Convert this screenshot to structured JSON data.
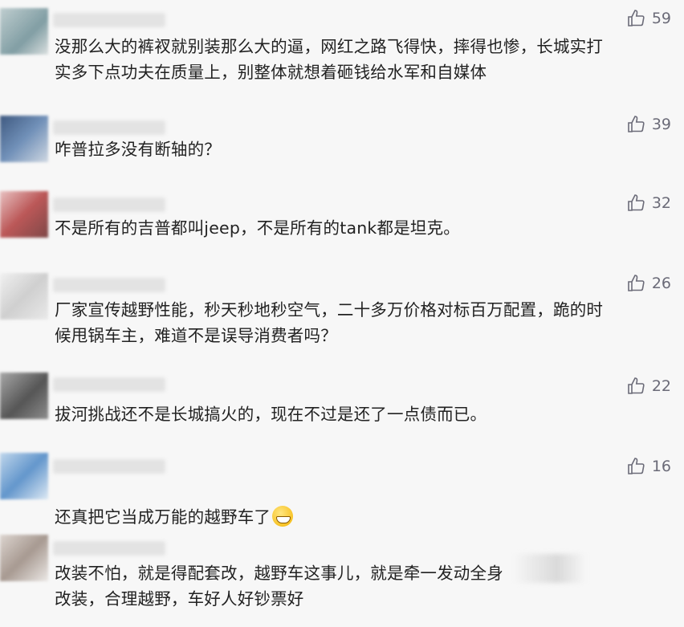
{
  "comments": [
    {
      "avatar_color": "#7aa0a8",
      "text": "没那么大的裤衩就别装那么大的逼，网红之路飞得快，摔得也惨，长城实打\n实多下点功夫在质量上，别整体就想着砸钱给水军和自媒体",
      "likes": "59"
    },
    {
      "avatar_color": "#3b5b88",
      "text": "咋普拉多没有断轴的？",
      "likes": "39"
    },
    {
      "avatar_color": "#b13c3c",
      "text": "不是所有的吉普都叫jeep，不是所有的tank都是坦克。",
      "likes": "32"
    },
    {
      "avatar_color": "#c9c9c9",
      "text": "厂家宣传越野性能，秒天秒地秒空气，二十多万价格对标百万配置，跪的时\n候甩锅车主，难道不是误导消费者吗？",
      "likes": "26"
    },
    {
      "avatar_color": "#5a5a5a",
      "text": "拔河挑战还不是长城搞火的，现在不过是还了一点债而已。",
      "likes": "22"
    },
    {
      "avatar_color": "#4a86c5",
      "text": "还真把它当成万能的越野车了",
      "emoji": "grinning-face-icon",
      "likes": "16"
    },
    {
      "avatar_color": "#9a8a80",
      "text": "改装不怕，就是得配套改，越野车这事儿，就是牵一发动全身\n改装，合理越野，车好人好钞票好",
      "likes": ""
    }
  ],
  "icons": {
    "like": "thumbs-up-icon"
  }
}
